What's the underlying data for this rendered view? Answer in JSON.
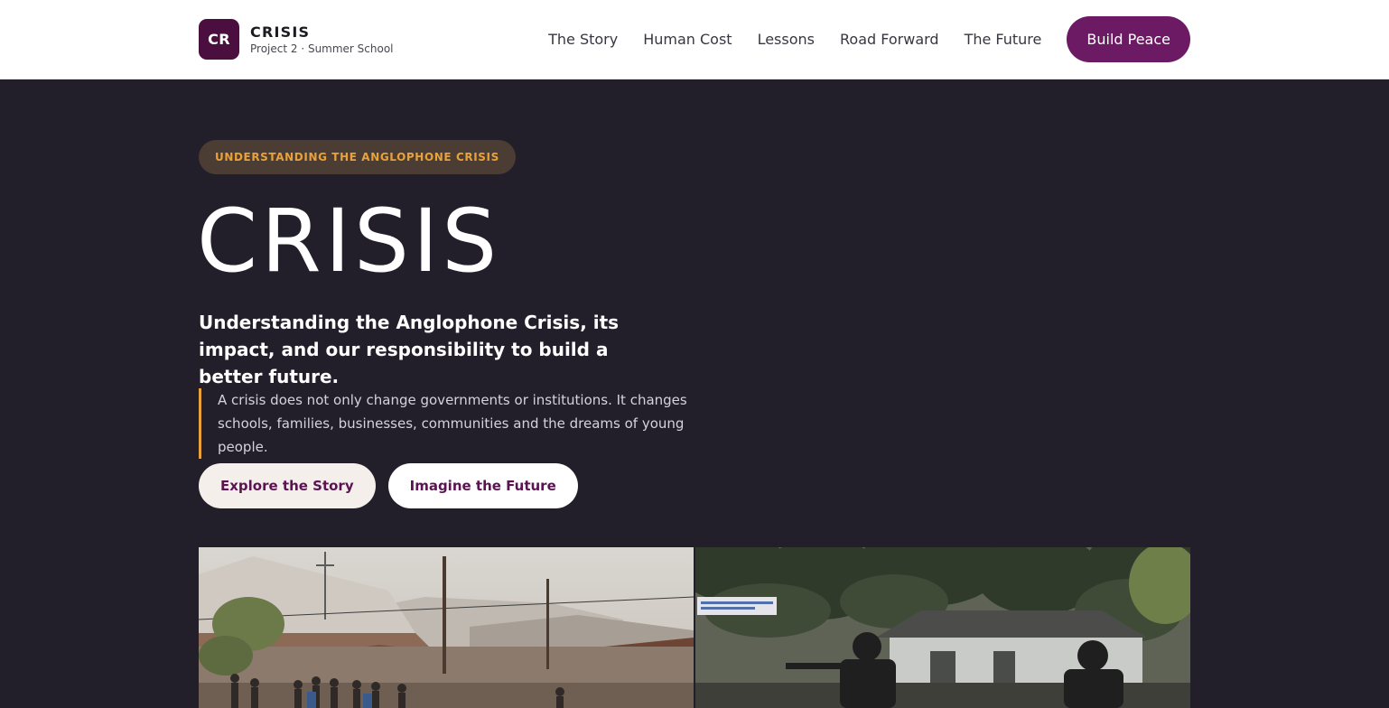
{
  "brand": {
    "mark": "CR",
    "name": "CRISIS",
    "subtitle": "Project 2 · Summer School"
  },
  "nav": {
    "items": [
      {
        "label": "The Story"
      },
      {
        "label": "Human Cost"
      },
      {
        "label": "Lessons"
      },
      {
        "label": "Road Forward"
      },
      {
        "label": "The Future"
      }
    ],
    "cta_label": "Build Peace"
  },
  "hero": {
    "eyebrow": "UNDERSTANDING THE ANGLOPHONE CRISIS",
    "title": "CRISIS",
    "subtitle": "Understanding the Anglophone Crisis, its impact, and our responsibility to build a better future.",
    "quote": "A crisis does not only change governments or institutions. It changes schools, families, businesses, communities and the dreams of young people.",
    "primary_button": "Explore the Story",
    "secondary_button": "Imagine the Future"
  },
  "colors": {
    "background": "#221f2b",
    "brand": "#6b1a63",
    "accent": "#e9a23a"
  }
}
